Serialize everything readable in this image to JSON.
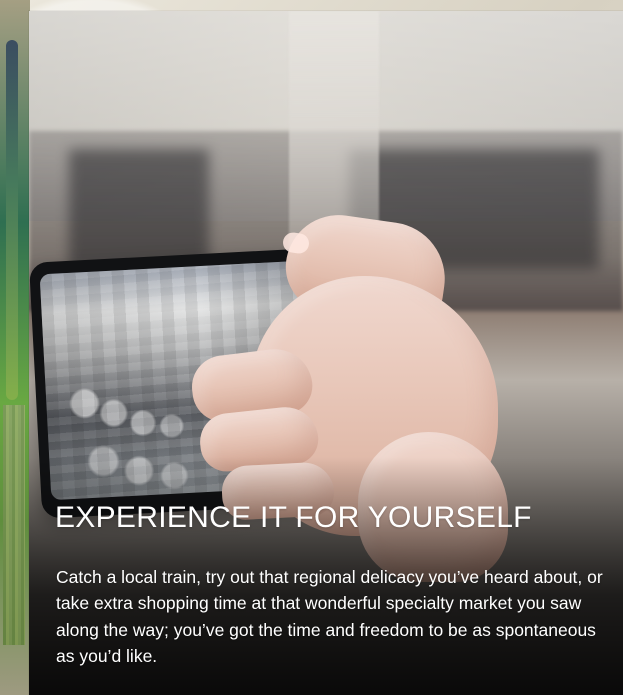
{
  "hero": {
    "title": "EXPERIENCE IT FOR YOURSELF",
    "body": "Catch a local train, try out that regional delicacy you’ve heard about, or take extra shopping time at that wonderful specialty market you saw along the way; you’ve got the time and freedom to be as spontaneous as you’d like."
  }
}
